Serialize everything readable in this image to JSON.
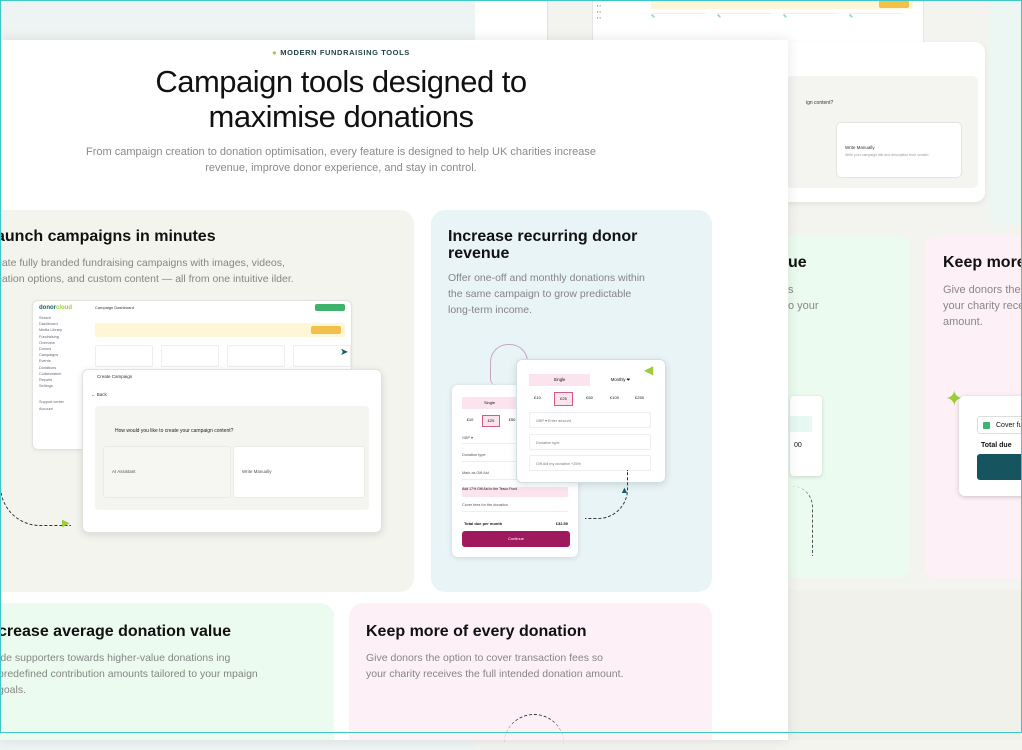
{
  "eyebrow": "MODERN FUNDRAISING TOOLS",
  "title_line1": "Campaign tools designed to",
  "title_line2": "maximise donations",
  "subtitle": "From campaign creation to donation optimisation, every feature is designed to help UK charities increase revenue, improve donor experience, and stay in control.",
  "cards": [
    {
      "title": "aunch campaigns in minutes",
      "body": "eate fully branded fundraising campaigns with images, videos, nation options, and custom content — all from one intuitive ilder."
    },
    {
      "title": "Increase recurring donor revenue",
      "body": "Offer one-off and monthly donations within the same campaign to grow predictable long-term income."
    },
    {
      "title": "crease average donation value",
      "body": "ide supporters towards higher-value donations ing predefined contribution amounts tailored to your mpaign goals."
    },
    {
      "title": "Keep more of every donation",
      "body": "Give donors the option to cover transaction fees so your charity receives the full intended donation amount."
    }
  ],
  "dashboard": {
    "logo_main": "donor",
    "logo_accent": "cloud",
    "header": "Campaign Dashboard",
    "sidebar": [
      "Search",
      "Dashboard",
      "Media Library",
      "Fundraising",
      "Overview",
      "Donors",
      "Campaigns",
      "Events",
      "Donations",
      "Collaboration",
      "Reports",
      "Settings",
      "Support center",
      "Account"
    ],
    "modal_title": "Create Campaign",
    "modal_back": "← Back",
    "modal_question": "How would you like to create your campaign content?",
    "option1": "AI Assistant",
    "option2": "Write Manually"
  },
  "donation_front": {
    "tabs": [
      "Single",
      "Monthly ❤"
    ],
    "amounts": [
      "£10",
      "£25",
      "£50",
      "£100",
      "£250"
    ],
    "fields": [
      "GBP ▾   Enter amount",
      "Donation type",
      "Gift Aid my donation +25%"
    ]
  },
  "donation_back": {
    "tab": "Single",
    "amounts": [
      "£10",
      "£25",
      "£50"
    ],
    "rows": [
      "GBP ▾",
      "Donation type",
      "Mark as Gift Aid",
      "Cover fees for the donation"
    ],
    "warning": "Add 17% Gift Aid to the Tesco Fund",
    "total_label": "Total due per month",
    "total_value": "£32.50",
    "continue": "Continue",
    "secure": "Secured by Stripe"
  },
  "background": {
    "green_title": "ue",
    "green_lines": [
      "s",
      "o your",
      ""
    ],
    "green_value": "00",
    "pink_title": "Keep more",
    "pink_lines": [
      "Give donors the",
      "your charity rece",
      "amount."
    ],
    "pink_check": "Cover fu",
    "pink_due": "Total due",
    "top_question": "ign content?",
    "top_option": "Write Manually",
    "top_option_sub": "Write your campaign title and description from scratch"
  },
  "colors": {
    "accent": "#9ccb3b",
    "teal": "#145c66",
    "magenta": "#a0195e"
  }
}
